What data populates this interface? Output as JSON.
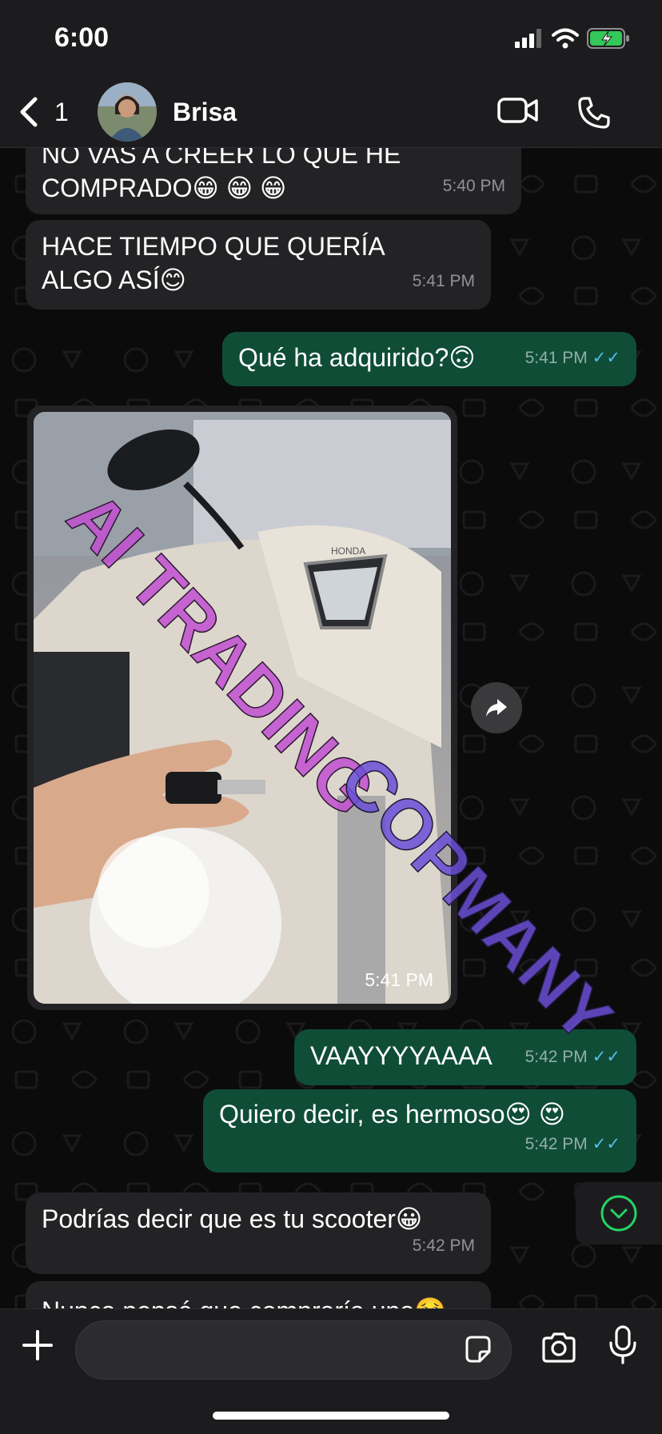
{
  "status_bar": {
    "time": "6:00"
  },
  "header": {
    "back_count": "1",
    "contact_name": "Brisa"
  },
  "messages": [
    {
      "text": "NO VAS A CREER LO QUE HE COMPRADO😁 😁 😁",
      "time": "5:40 PM"
    },
    {
      "text": "HACE TIEMPO QUE QUERÍA ALGO ASÍ😊",
      "time": "5:41 PM"
    },
    {
      "text": "Qué ha adquirido?🙃",
      "time": "5:41 PM"
    },
    {
      "image_time": "5:41 PM"
    },
    {
      "text": "VAAYYYYAAAA",
      "time": "5:42 PM"
    },
    {
      "text": "Quiero decir, es hermoso😍 😍",
      "time": "5:42 PM"
    },
    {
      "text": "Podrías decir que es tu scooter😀",
      "time": "5:42 PM"
    },
    {
      "text": "Nunca pensé que compraría uno🥹",
      "time": ""
    }
  ],
  "watermark": {
    "line1": "AI TRADING",
    "line2": "COPMANY"
  },
  "composer": {
    "placeholder": ""
  },
  "colors": {
    "incoming": "#232325",
    "outgoing": "#0f4d37",
    "read_ticks": "#53bdeb",
    "accent_green": "#25d366"
  }
}
